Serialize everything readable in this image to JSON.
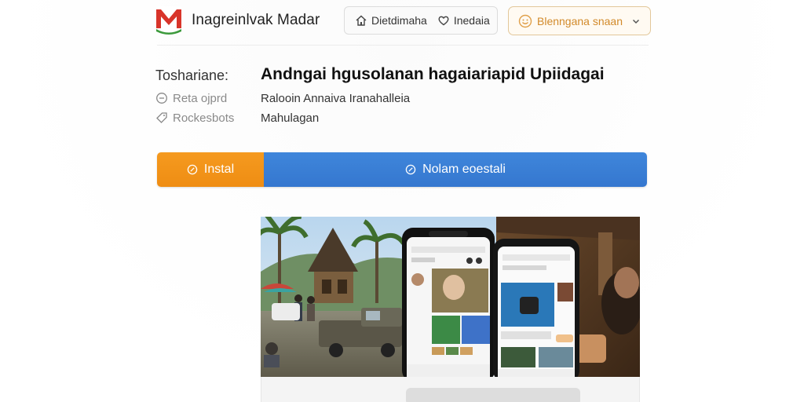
{
  "header": {
    "brand": "Inagreinlvak Madar",
    "nav": [
      {
        "label": "Dietdimaha",
        "icon": "home-icon"
      },
      {
        "label": "Inedaia",
        "icon": "heart-icon"
      }
    ],
    "language": {
      "label": "Blenngana snaan",
      "icon": "smiley-icon"
    }
  },
  "info": {
    "key": "Toshariane:",
    "title": "Andngai hgusolanan hagaiariapid Upiidagai",
    "meta": [
      {
        "key": "Reta ojprd",
        "icon": "clock-icon",
        "value": "Ralooin Annaiva Iranahalleia"
      },
      {
        "key": "Rockesbots",
        "icon": "tag-icon",
        "value": "Mahulagan"
      }
    ]
  },
  "actions": {
    "install": "Instal",
    "secondary": "Nolam eoestali"
  },
  "colors": {
    "install": "#ef8d13",
    "secondary": "#3577cf",
    "language_accent": "#d28a2a",
    "logo_red": "#d8342a",
    "logo_green": "#3c9a3c"
  }
}
